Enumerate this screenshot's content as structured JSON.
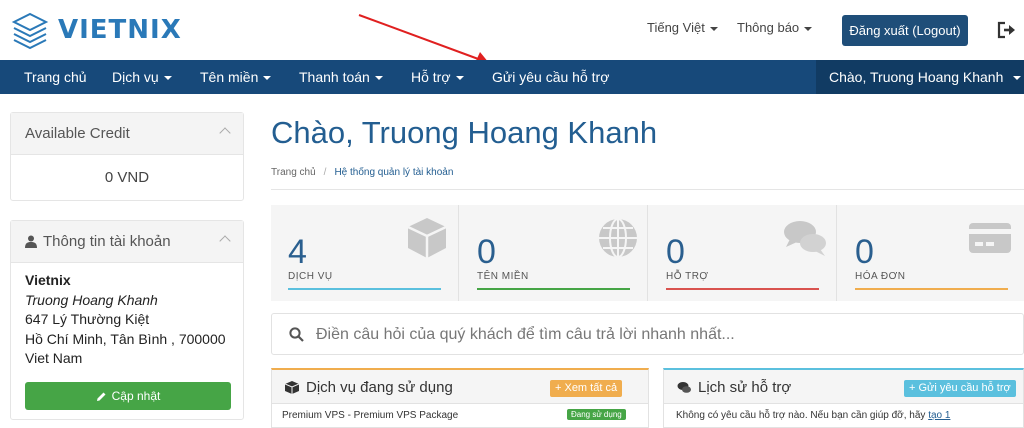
{
  "header": {
    "logo_text": "VIETNIX",
    "language_label": "Tiếng Việt",
    "notifications_label": "Thông báo",
    "logout_label": "Đăng xuất (Logout)"
  },
  "nav": {
    "items": [
      {
        "label": "Trang chủ"
      },
      {
        "label": "Dịch vụ"
      },
      {
        "label": "Tên miền"
      },
      {
        "label": "Thanh toán"
      },
      {
        "label": "Hỗ trợ"
      },
      {
        "label": "Gửi yêu cầu hỗ trợ"
      }
    ],
    "greeting": "Chào, Truong Hoang Khanh"
  },
  "sidebar": {
    "credit": {
      "title": "Available Credit",
      "value": "0 VND"
    },
    "account": {
      "title": "Thông tin tài khoản",
      "company": "Vietnix",
      "name": "Truong Hoang Khanh",
      "address": "647 Lý Thường Kiệt",
      "city": "Hồ Chí Minh, Tân Bình , 700000",
      "country": "Viet Nam",
      "update_label": "Cập nhật"
    }
  },
  "main": {
    "title": "Chào, Truong Hoang Khanh",
    "breadcrumb": {
      "home": "Trang chủ",
      "current": "Hệ thống quản lý tài khoản"
    },
    "tiles": [
      {
        "value": "4",
        "label": "DỊCH VỤ",
        "icon": "cube-icon",
        "color": "#5bc0de"
      },
      {
        "value": "0",
        "label": "TÊN MIỀN",
        "icon": "globe-icon",
        "color": "#46a546"
      },
      {
        "value": "0",
        "label": "HỖ TRỢ",
        "icon": "chat-icon",
        "color": "#d9534f"
      },
      {
        "value": "0",
        "label": "HÓA ĐƠN",
        "icon": "credit-card-icon",
        "color": "#f0ad4e"
      }
    ],
    "search": {
      "placeholder": "Điền câu hỏi của quý khách để tìm câu trả lời nhanh nhất..."
    },
    "services_card": {
      "title": "Dịch vụ đang sử dụng",
      "button": "+ Xem tất cả",
      "row": "Premium VPS - Premium VPS Package",
      "status": "Đang sử dụng"
    },
    "support_card": {
      "title": "Lịch sử hỗ trợ",
      "button": "+ Gửi yêu cầu hỗ trợ",
      "row_text": "Không có yêu cầu hỗ trợ nào. Nếu bạn cần giúp đỡ, hãy",
      "row_link": "tạo 1"
    }
  },
  "colors": {
    "nav_bg": "#17497a",
    "accent": "#235e91",
    "success": "#46a546",
    "warning": "#f0ad4e",
    "info": "#5bc0de"
  }
}
